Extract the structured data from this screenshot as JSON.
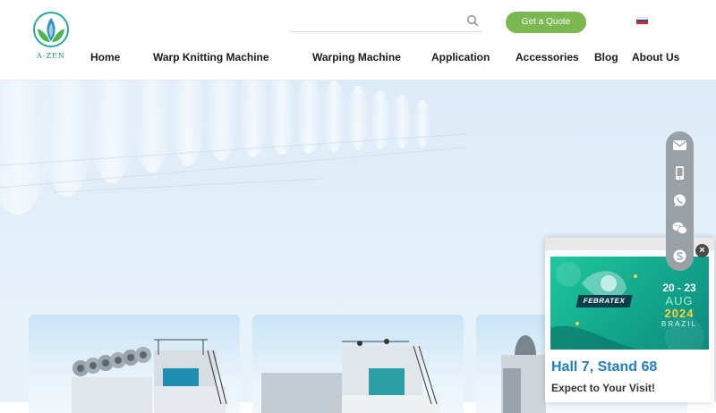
{
  "brand": {
    "logo_text": "A-ZEN",
    "accent": "#7cb851",
    "logo_color": "#1d8f8f"
  },
  "search": {
    "placeholder": "",
    "icon": "search-icon"
  },
  "header": {
    "quote_label": "Get a Quote",
    "flag": "russia-flag-icon"
  },
  "nav": {
    "items": [
      {
        "label": "Home"
      },
      {
        "label": "Warp Knitting Machine"
      },
      {
        "label": "Warping Machine"
      },
      {
        "label": "Application"
      },
      {
        "label": "Accessories"
      },
      {
        "label": "Blog"
      },
      {
        "label": "About Us"
      }
    ]
  },
  "sidebar": {
    "icons": [
      "email-icon",
      "mobile-icon",
      "whatsapp-icon",
      "wechat-icon",
      "skype-icon"
    ]
  },
  "popup": {
    "banner": {
      "brand": "FEBRATEX",
      "date": "20 - 23",
      "month": "AUG",
      "year": "2024",
      "country": "BRAZIL"
    },
    "title": "Hall 7, Stand 68",
    "subtitle": "Expect to Your Visit!",
    "close": "×"
  }
}
